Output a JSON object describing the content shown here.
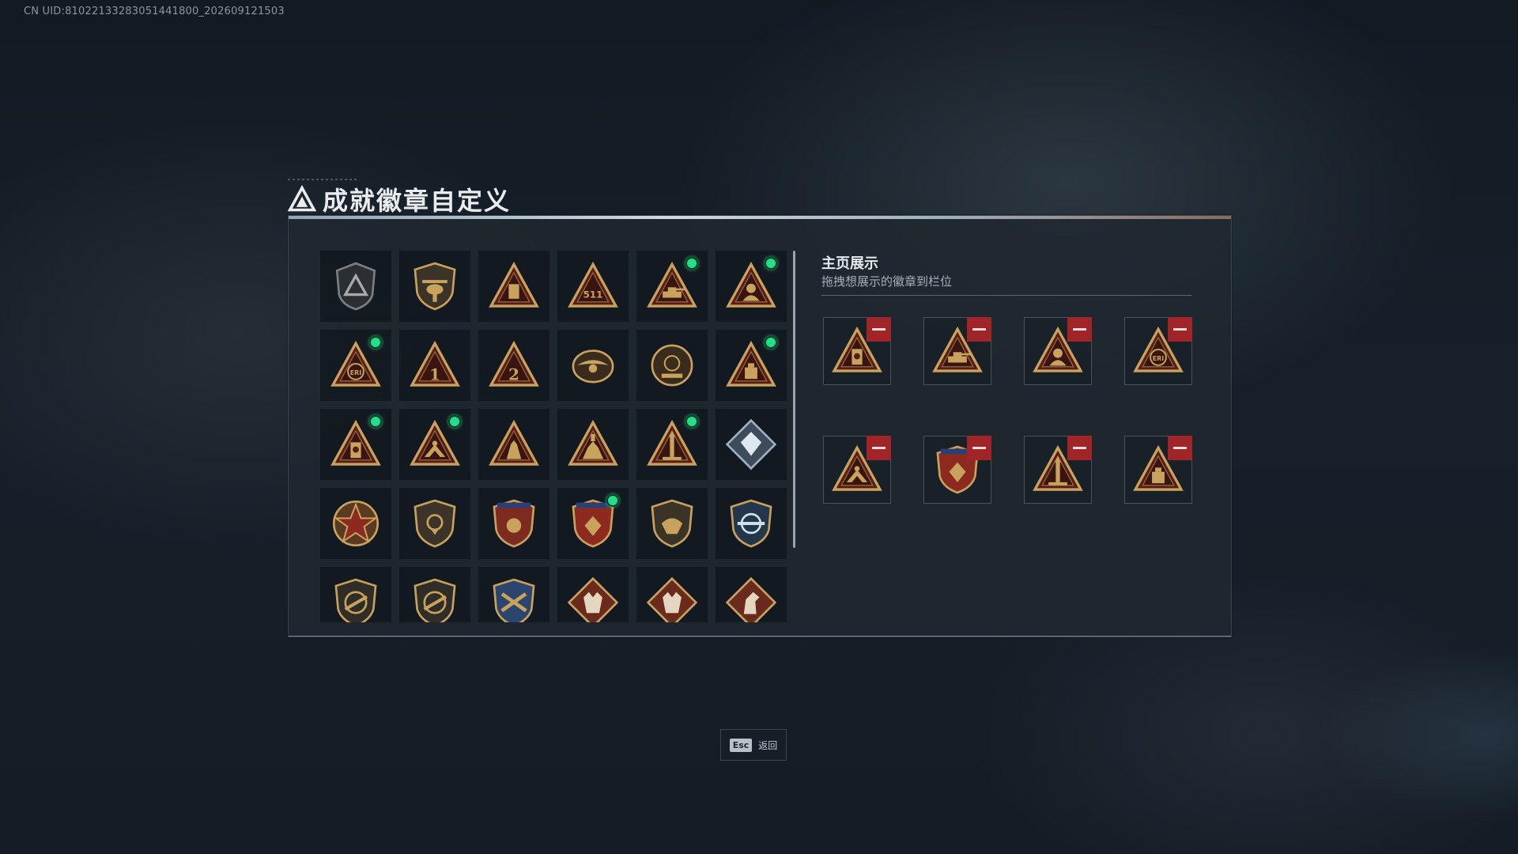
{
  "uid_text": "CN UID:81022133283051441800_202609121503",
  "title": "成就徽章自定义",
  "colors": {
    "gold": "#c9a25e",
    "dark_red": "#5a1c16",
    "new_dot": "#21e08a",
    "remove": "#a02428"
  },
  "badges": [
    {
      "icon": "shield-delta-icon",
      "new": false
    },
    {
      "icon": "helicopter-shield-icon",
      "new": false
    },
    {
      "icon": "triangle-door-icon",
      "new": false
    },
    {
      "icon": "triangle-511-icon",
      "new": false
    },
    {
      "icon": "triangle-tank-icon",
      "new": true
    },
    {
      "icon": "triangle-soldier-icon",
      "new": true
    },
    {
      "icon": "triangle-globe-eri-icon",
      "new": true
    },
    {
      "icon": "triangle-number-1-icon",
      "new": false
    },
    {
      "icon": "triangle-number-2-icon",
      "new": false
    },
    {
      "icon": "winged-emblem-icon",
      "new": false
    },
    {
      "icon": "delta-force-2020-icon",
      "new": false
    },
    {
      "icon": "triangle-box-icon",
      "new": true
    },
    {
      "icon": "triangle-medal-icon",
      "new": true
    },
    {
      "icon": "triangle-hands-icon",
      "new": true
    },
    {
      "icon": "triangle-statue-icon",
      "new": false
    },
    {
      "icon": "triangle-monument-icon",
      "new": false
    },
    {
      "icon": "triangle-rocket-icon",
      "new": true
    },
    {
      "icon": "diamond-crystal-icon",
      "new": false
    },
    {
      "icon": "star-wreath-icon",
      "new": false
    },
    {
      "icon": "shield-gear-icon",
      "new": false
    },
    {
      "icon": "crest-stars-icon",
      "new": false
    },
    {
      "icon": "crest-stars-red-icon",
      "new": true
    },
    {
      "icon": "eagle-shield-icon",
      "new": false
    },
    {
      "icon": "crosshair-rifle-shield-icon",
      "new": false
    },
    {
      "icon": "rifle-shield-icon",
      "new": false
    },
    {
      "icon": "rifle-shield-icon",
      "new": false
    },
    {
      "icon": "crossed-rifles-shield-icon",
      "new": false
    },
    {
      "icon": "wolf-diamond-icon",
      "new": false
    },
    {
      "icon": "wolf-diamond-icon",
      "new": false
    },
    {
      "icon": "horse-diamond-icon",
      "new": false
    }
  ],
  "showcase": {
    "title": "主页展示",
    "subtitle": "拖拽想展示的徽章到栏位",
    "slots": [
      {
        "icon": "triangle-medal-icon"
      },
      {
        "icon": "triangle-tank-icon"
      },
      {
        "icon": "triangle-soldier-icon"
      },
      {
        "icon": "triangle-globe-eri-icon"
      },
      {
        "icon": "triangle-hands-icon"
      },
      {
        "icon": "crest-stars-red-icon"
      },
      {
        "icon": "triangle-rocket-icon"
      },
      {
        "icon": "triangle-box-icon"
      }
    ]
  },
  "footer": {
    "key": "Esc",
    "label": "返回"
  }
}
